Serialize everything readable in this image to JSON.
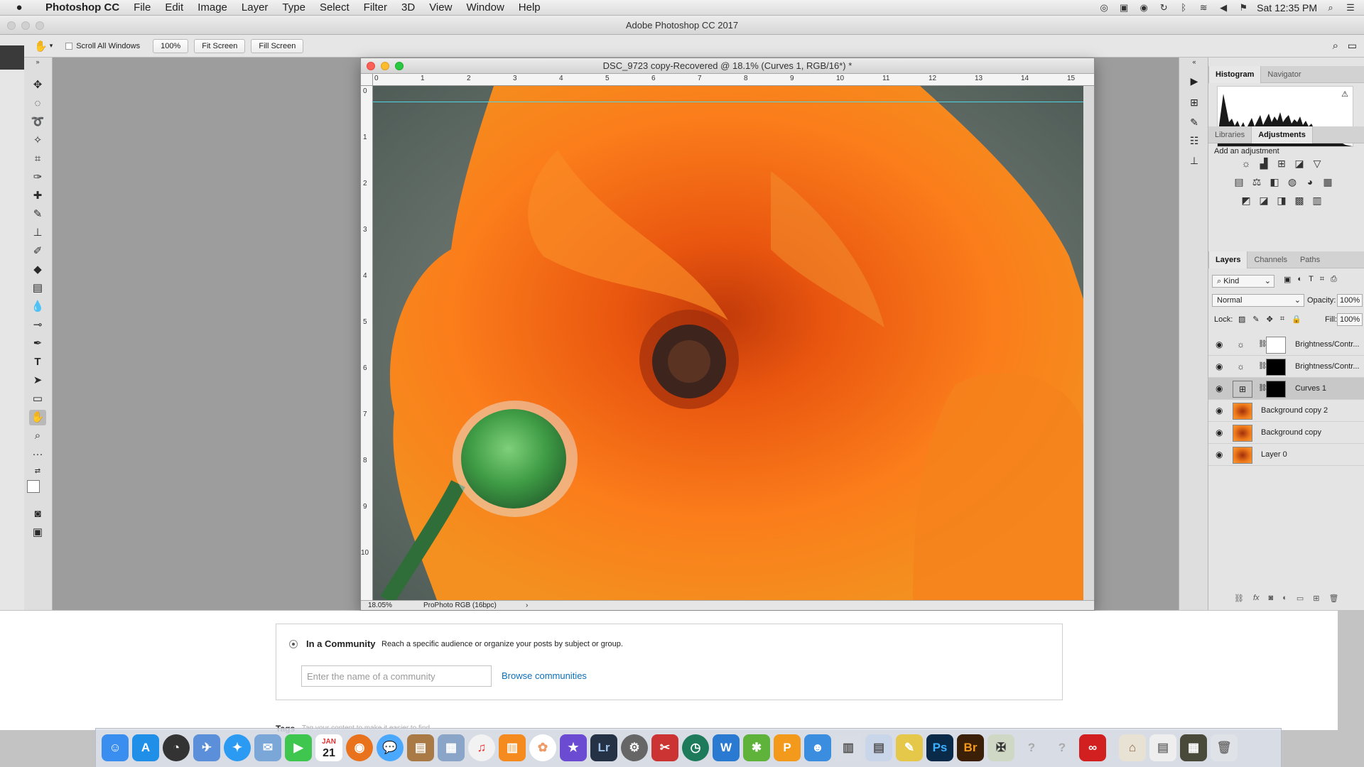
{
  "menubar": {
    "apple_icon": "apple-logo",
    "app_name": "Photoshop CC",
    "items": [
      "File",
      "Edit",
      "Image",
      "Layer",
      "Type",
      "Select",
      "Filter",
      "3D",
      "View",
      "Window",
      "Help"
    ],
    "clock": "Sat 12:35 PM"
  },
  "window_title": "Adobe Photoshop CC 2017",
  "options": {
    "scroll_all": "Scroll All Windows",
    "zoom_100": "100%",
    "fit_screen": "Fit Screen",
    "fill_screen": "Fill Screen"
  },
  "document": {
    "title": "DSC_9723 copy-Recovered @ 18.1% (Curves 1, RGB/16*) *",
    "ruler_top": [
      "0",
      "1",
      "2",
      "3",
      "4",
      "5",
      "6",
      "7",
      "8",
      "9",
      "10",
      "11",
      "12",
      "13",
      "14",
      "15"
    ],
    "ruler_left": [
      "0",
      "1",
      "2",
      "3",
      "4",
      "5",
      "6",
      "7",
      "8",
      "9",
      "10"
    ],
    "zoom": "18.05%",
    "profile": "ProPhoto RGB (16bpc)",
    "status_arrow": "›"
  },
  "panels": {
    "tab_histogram": "Histogram",
    "tab_navigator": "Navigator",
    "tab_libraries": "Libraries",
    "tab_adjustments": "Adjustments",
    "add_adjustment": "Add an adjustment",
    "tab_layers": "Layers",
    "tab_channels": "Channels",
    "tab_paths": "Paths",
    "kind": "Kind",
    "blend_mode": "Normal",
    "opacity_label": "Opacity:",
    "opacity_value": "100%",
    "lock_label": "Lock:",
    "fill_label": "Fill:",
    "fill_value": "100%",
    "layers": [
      {
        "name": "Brightness/Contr...",
        "type": "adjustment"
      },
      {
        "name": "Brightness/Contr...",
        "type": "adjustment"
      },
      {
        "name": "Curves 1",
        "type": "adjustment",
        "selected": true
      },
      {
        "name": "Background copy 2",
        "type": "pixel"
      },
      {
        "name": "Background copy",
        "type": "pixel"
      },
      {
        "name": "Layer 0",
        "type": "pixel"
      }
    ]
  },
  "page": {
    "community_title": "In a Community",
    "community_desc": "Reach a specific audience or organize your posts by subject or group.",
    "community_placeholder": "Enter the name of a community",
    "browse": "Browse communities",
    "tags_label": "Tags",
    "tags_hint": "Tag your content to make it easier to find"
  },
  "dock": {
    "lightroom": "Lr",
    "photoshop": "Ps",
    "bridge": "Br",
    "calendar_month": "JAN",
    "calendar_day": "21"
  },
  "colors": {
    "accent_link": "#0b6fb8",
    "flower": "#f07a1a",
    "bud": "#4fa64a"
  }
}
